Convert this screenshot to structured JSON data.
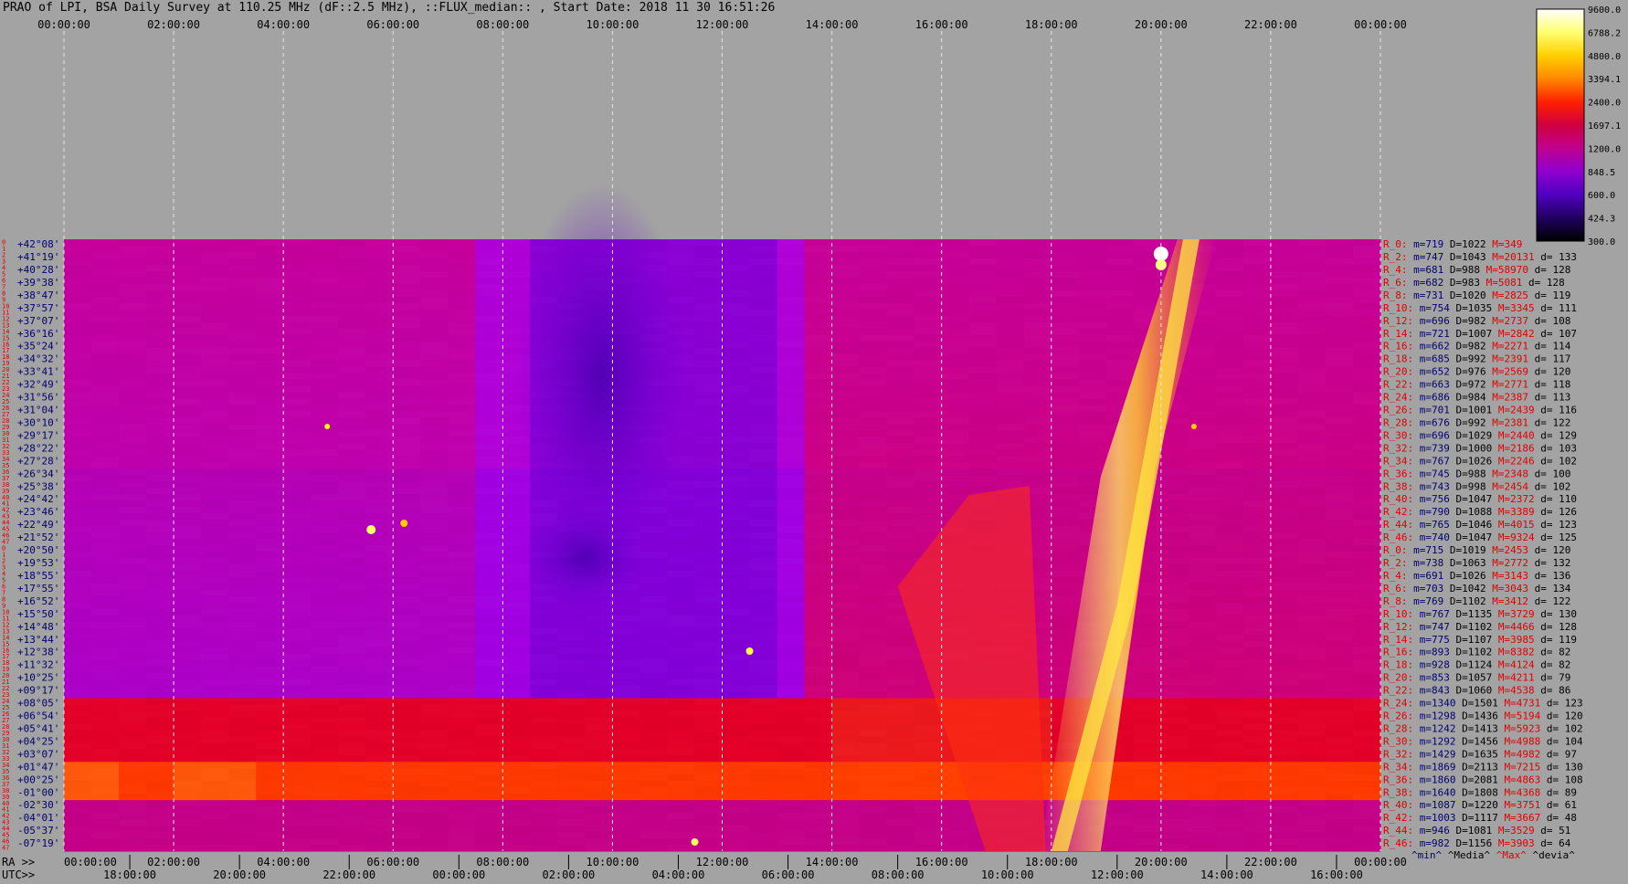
{
  "page": {
    "title": "PRAO of LPI, BSA Daily Survey at 110.25 MHz (dF::2.5 MHz), ::FLUX_median:: , Start Date: 2018 11 30 16:51:26"
  },
  "axis": {
    "top_time_labels": [
      "00:00:00",
      "02:00:00",
      "04:00:00",
      "06:00:00",
      "08:00:00",
      "10:00:00",
      "12:00:00",
      "14:00:00",
      "16:00:00",
      "18:00:00",
      "20:00:00",
      "22:00:00",
      "00:00:00"
    ],
    "ra_prefix": "RA >>",
    "ra_labels": [
      "00:00:00",
      "02:00:00",
      "04:00:00",
      "06:00:00",
      "08:00:00",
      "10:00:00",
      "12:00:00",
      "14:00:00",
      "16:00:00",
      "18:00:00",
      "20:00:00",
      "22:00:00",
      "00:00:00"
    ],
    "utc_prefix": "UTC>>",
    "utc_labels": [
      "18:00:00",
      "20:00:00",
      "22:00:00",
      "00:00:00",
      "02:00:00",
      "04:00:00",
      "06:00:00",
      "08:00:00",
      "10:00:00",
      "12:00:00",
      "14:00:00",
      "16:00:00"
    ]
  },
  "colorbar": {
    "tick_labels": [
      "9600.0",
      "6788.2",
      "4800.0",
      "3394.1",
      "2400.0",
      "1697.1",
      "1200.0",
      "848.5",
      "600.0",
      "424.3",
      "300.0"
    ],
    "stops": [
      "#ffffff",
      "#ffff70",
      "#ffd000",
      "#ff8800",
      "#ff2000",
      "#d00040",
      "#c00090",
      "#9000d0",
      "#5000c0",
      "#200060",
      "#000000"
    ]
  },
  "beams": {
    "declinations": [
      "+42°08'",
      "+41°19'",
      "+40°28'",
      "+39°38'",
      "+38°47'",
      "+37°57'",
      "+37°07'",
      "+36°16'",
      "+35°24'",
      "+34°32'",
      "+33°41'",
      "+32°49'",
      "+31°56'",
      "+31°04'",
      "+30°10'",
      "+29°17'",
      "+28°22'",
      "+27°28'",
      "+26°34'",
      "+25°38'",
      "+24°42'",
      "+23°46'",
      "+22°49'",
      "+21°52'",
      "+20°50'",
      "+19°53'",
      "+18°55'",
      "+17°55'",
      "+16°52'",
      "+15°50'",
      "+14°48'",
      "+13°44'",
      "+12°38'",
      "+11°32'",
      "+10°25'",
      "+09°17'",
      "+08°05'",
      "+06°54'",
      "+05°41'",
      "+04°25'",
      "+03°07'",
      "+01°47'",
      "+00°25'",
      "-01°00'",
      "-02°30'",
      "-04°01'",
      "-05°37'",
      "-07°19'"
    ],
    "row_numbers": [
      "0",
      "1",
      "2",
      "3",
      "4",
      "5",
      "6",
      "7",
      "8",
      "9",
      "10",
      "11",
      "12",
      "13",
      "14",
      "15",
      "16",
      "17",
      "18",
      "19",
      "20",
      "21",
      "22",
      "23",
      "24",
      "25",
      "26",
      "27",
      "28",
      "29",
      "30",
      "31",
      "32",
      "33",
      "34",
      "35",
      "36",
      "37",
      "38",
      "39",
      "40",
      "41",
      "42",
      "43",
      "44",
      "45",
      "46",
      "47",
      "0",
      "1",
      "2",
      "3",
      "4",
      "5",
      "6",
      "7",
      "8",
      "9",
      "10",
      "11",
      "12",
      "13",
      "14",
      "15",
      "16",
      "17",
      "18",
      "19",
      "20",
      "21",
      "22",
      "23",
      "24",
      "25",
      "26",
      "27",
      "28",
      "29",
      "30",
      "31",
      "32",
      "33",
      "34",
      "35",
      "36",
      "37",
      "38",
      "39",
      "40",
      "41",
      "42",
      "43",
      "44",
      "45",
      "46",
      "47"
    ]
  },
  "stats": {
    "rows": [
      {
        "label": "R_0:",
        "m": "m=719",
        "D": "D=1022",
        "M": "M=349",
        "d": ""
      },
      {
        "label": "R_2:",
        "m": "m=747",
        "D": "D=1043",
        "M": "M=20131",
        "d": "d= 133"
      },
      {
        "label": "R_4:",
        "m": "m=681",
        "D": "D=988",
        "M": "M=58970",
        "d": "d= 128"
      },
      {
        "label": "R_6:",
        "m": "m=682",
        "D": "D=983",
        "M": "M=5081",
        "d": "d= 128"
      },
      {
        "label": "R_8:",
        "m": "m=731",
        "D": "D=1020",
        "M": "M=2825",
        "d": "d= 119"
      },
      {
        "label": "R_10:",
        "m": "m=754",
        "D": "D=1035",
        "M": "M=3345",
        "d": "d= 111"
      },
      {
        "label": "R_12:",
        "m": "m=696",
        "D": "D=982",
        "M": "M=2737",
        "d": "d= 108"
      },
      {
        "label": "R_14:",
        "m": "m=721",
        "D": "D=1007",
        "M": "M=2842",
        "d": "d= 107"
      },
      {
        "label": "R_16:",
        "m": "m=662",
        "D": "D=982",
        "M": "M=2271",
        "d": "d= 114"
      },
      {
        "label": "R_18:",
        "m": "m=685",
        "D": "D=992",
        "M": "M=2391",
        "d": "d= 117"
      },
      {
        "label": "R_20:",
        "m": "m=652",
        "D": "D=976",
        "M": "M=2569",
        "d": "d= 120"
      },
      {
        "label": "R_22:",
        "m": "m=663",
        "D": "D=972",
        "M": "M=2771",
        "d": "d= 118"
      },
      {
        "label": "R_24:",
        "m": "m=686",
        "D": "D=984",
        "M": "M=2387",
        "d": "d= 113"
      },
      {
        "label": "R_26:",
        "m": "m=701",
        "D": "D=1001",
        "M": "M=2439",
        "d": "d= 116"
      },
      {
        "label": "R_28:",
        "m": "m=676",
        "D": "D=992",
        "M": "M=2381",
        "d": "d= 122"
      },
      {
        "label": "R_30:",
        "m": "m=696",
        "D": "D=1029",
        "M": "M=2440",
        "d": "d= 129"
      },
      {
        "label": "R_32:",
        "m": "m=739",
        "D": "D=1000",
        "M": "M=2186",
        "d": "d= 103"
      },
      {
        "label": "R_34:",
        "m": "m=767",
        "D": "D=1026",
        "M": "M=2246",
        "d": "d= 102"
      },
      {
        "label": "R_36:",
        "m": "m=745",
        "D": "D=988",
        "M": "M=2348",
        "d": "d= 100"
      },
      {
        "label": "R_38:",
        "m": "m=743",
        "D": "D=998",
        "M": "M=2454",
        "d": "d= 102"
      },
      {
        "label": "R_40:",
        "m": "m=756",
        "D": "D=1047",
        "M": "M=2372",
        "d": "d= 110"
      },
      {
        "label": "R_42:",
        "m": "m=790",
        "D": "D=1088",
        "M": "M=3389",
        "d": "d= 126"
      },
      {
        "label": "R_44:",
        "m": "m=765",
        "D": "D=1046",
        "M": "M=4015",
        "d": "d= 123"
      },
      {
        "label": "R_46:",
        "m": "m=740",
        "D": "D=1047",
        "M": "M=9324",
        "d": "d= 125"
      },
      {
        "label": "R_0:",
        "m": "m=715",
        "D": "D=1019",
        "M": "M=2453",
        "d": "d= 120"
      },
      {
        "label": "R_2:",
        "m": "m=738",
        "D": "D=1063",
        "M": "M=2772",
        "d": "d= 132"
      },
      {
        "label": "R_4:",
        "m": "m=691",
        "D": "D=1026",
        "M": "M=3143",
        "d": "d= 136"
      },
      {
        "label": "R_6:",
        "m": "m=703",
        "D": "D=1042",
        "M": "M=3043",
        "d": "d= 134"
      },
      {
        "label": "R_8:",
        "m": "m=769",
        "D": "D=1102",
        "M": "M=3412",
        "d": "d= 122"
      },
      {
        "label": "R_10:",
        "m": "m=767",
        "D": "D=1135",
        "M": "M=3729",
        "d": "d= 130"
      },
      {
        "label": "R_12:",
        "m": "m=747",
        "D": "D=1102",
        "M": "M=4466",
        "d": "d= 128"
      },
      {
        "label": "R_14:",
        "m": "m=775",
        "D": "D=1107",
        "M": "M=3985",
        "d": "d= 119"
      },
      {
        "label": "R_16:",
        "m": "m=893",
        "D": "D=1102",
        "M": "M=8382",
        "d": "d= 82"
      },
      {
        "label": "R_18:",
        "m": "m=928",
        "D": "D=1124",
        "M": "M=4124",
        "d": "d= 82"
      },
      {
        "label": "R_20:",
        "m": "m=853",
        "D": "D=1057",
        "M": "M=4211",
        "d": "d= 79"
      },
      {
        "label": "R_22:",
        "m": "m=843",
        "D": "D=1060",
        "M": "M=4538",
        "d": "d= 86"
      },
      {
        "label": "R_24:",
        "m": "m=1340",
        "D": "D=1501",
        "M": "M=4731",
        "d": "d= 123"
      },
      {
        "label": "R_26:",
        "m": "m=1298",
        "D": "D=1436",
        "M": "M=5194",
        "d": "d= 120"
      },
      {
        "label": "R_28:",
        "m": "m=1242",
        "D": "D=1413",
        "M": "M=5923",
        "d": "d= 102"
      },
      {
        "label": "R_30:",
        "m": "m=1292",
        "D": "D=1456",
        "M": "M=4988",
        "d": "d= 104"
      },
      {
        "label": "R_32:",
        "m": "m=1429",
        "D": "D=1635",
        "M": "M=4982",
        "d": "d= 97"
      },
      {
        "label": "R_34:",
        "m": "m=1869",
        "D": "D=2113",
        "M": "M=7215",
        "d": "d= 130"
      },
      {
        "label": "R_36:",
        "m": "m=1860",
        "D": "D=2081",
        "M": "M=4863",
        "d": "d= 108"
      },
      {
        "label": "R_38:",
        "m": "m=1640",
        "D": "D=1808",
        "M": "M=4368",
        "d": "d= 89"
      },
      {
        "label": "R_40:",
        "m": "m=1087",
        "D": "D=1220",
        "M": "M=3751",
        "d": "d= 61"
      },
      {
        "label": "R_42:",
        "m": "m=1003",
        "D": "D=1117",
        "M": "M=3667",
        "d": "d= 48"
      },
      {
        "label": "R_44:",
        "m": "m=946",
        "D": "D=1081",
        "M": "M=3529",
        "d": "d= 51"
      },
      {
        "label": "R_46:",
        "m": "m=982",
        "D": "D=1156",
        "M": "M=3903",
        "d": "d= 64"
      }
    ],
    "footer_min": "^min^",
    "footer_median": "^Media^",
    "footer_max": "^Max^",
    "footer_dev": "^devia^"
  },
  "chart_data": {
    "type": "heatmap",
    "x_label_top": "",
    "color_scale": "log",
    "value_range": [
      300.0,
      9600.0
    ],
    "features": [
      {
        "rows": [
          0,
          95
        ],
        "ra_hours": [
          8.5,
          12.5
        ],
        "level": "low"
      },
      {
        "rows": [
          72,
          83
        ],
        "ra_hours": [
          0,
          24
        ],
        "level": "elevated"
      },
      {
        "rows": [
          82,
          87
        ],
        "ra_hours": [
          0,
          24
        ],
        "level": "high"
      },
      {
        "rows": [
          0,
          95
        ],
        "ra_hours": [
          17.5,
          21.5
        ],
        "level": "high"
      }
    ]
  }
}
